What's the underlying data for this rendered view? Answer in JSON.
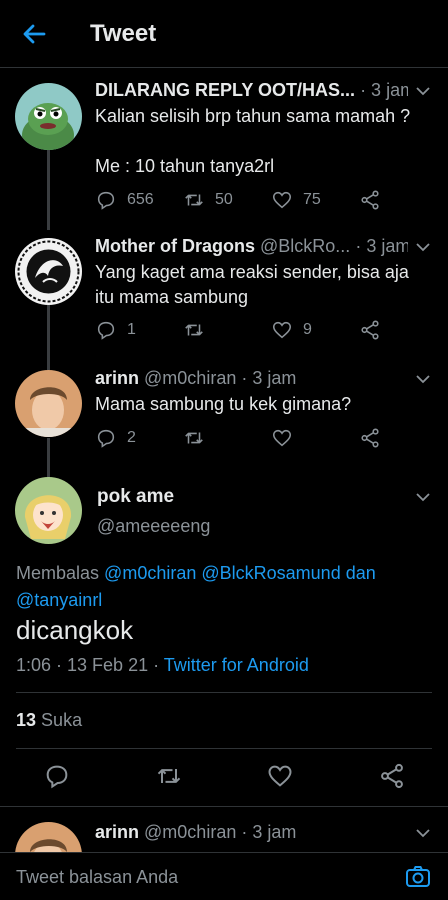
{
  "topbar": {
    "title": "Tweet"
  },
  "tweets": [
    {
      "name": "DILARANG REPLY OOT/HAS...",
      "handle": "",
      "time": "· 3 jam",
      "text_lines": [
        "Kalian selisih brp tahun sama mamah ?",
        "",
        "Me : 10 tahun tanya2rl"
      ],
      "replies": "656",
      "retweets": "50",
      "likes": "75"
    },
    {
      "name": "Mother of Dragons",
      "handle": "@BlckRo...",
      "time": "· 3 jam",
      "text_lines": [
        "Yang kaget ama reaksi sender, bisa aja",
        "itu mama sambung"
      ],
      "replies": "1",
      "retweets": "",
      "likes": "9"
    },
    {
      "name": "arinn",
      "handle": "@m0chiran",
      "time": "· 3 jam",
      "text_lines": [
        "Mama sambung tu kek gimana?"
      ],
      "replies": "2",
      "retweets": "",
      "likes": ""
    }
  ],
  "main": {
    "name": "pok ame",
    "handle": "@ameeeeeng",
    "reply_prefix": "Membalas",
    "reply_mentions": [
      "@m0chiran",
      "@BlckRosamund"
    ],
    "reply_and": "dan",
    "reply_last": "@tanyainrl",
    "text": "dicangkok",
    "time": "1:06 · 13 Feb 21 ·",
    "client": "Twitter for Android",
    "like_count": "13",
    "like_label": "Suka"
  },
  "bottom_tweet": {
    "name": "arinn",
    "handle": "@m0chiran",
    "time": "· 3 jam"
  },
  "composer": {
    "placeholder": "Tweet balasan Anda"
  },
  "colors": {
    "accent": "#1d9bf0",
    "muted": "#8b9298",
    "background": "#000000"
  }
}
